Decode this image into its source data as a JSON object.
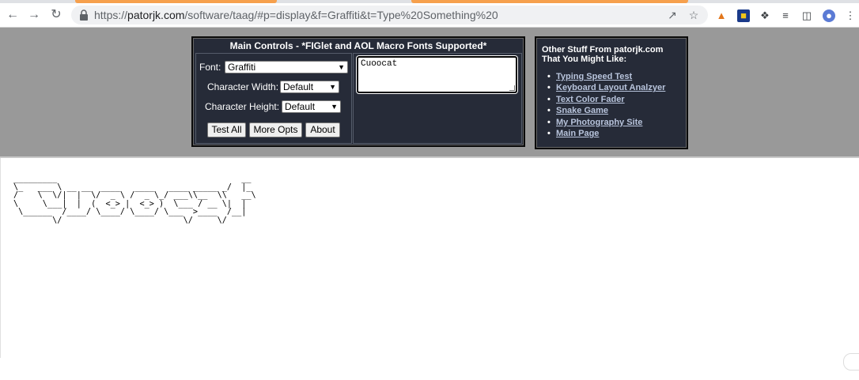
{
  "browser": {
    "url_prefix": "https://",
    "url_host": "patorjk.com",
    "url_rest": "/software/taag/#p=display&f=Graffiti&t=Type%20Something%20"
  },
  "main_controls": {
    "title": "Main Controls - *FIGlet and AOL Macro Fonts Supported*",
    "font_label": "Font:",
    "font_value": "Graffiti",
    "width_label": "Character Width:",
    "width_value": "Default",
    "height_label": "Character Height:",
    "height_value": "Default",
    "test_all_label": "Test All",
    "more_opts_label": "More Opts",
    "about_label": "About",
    "input_text": "Cuoocat"
  },
  "other_stuff": {
    "title_line1": "Other Stuff From patorjk.com",
    "title_line2": "That You Might Like:",
    "links": [
      "Typing Speed Test",
      "Keyboard Layout Analzyer",
      "Text Color Fader",
      "Snake Game",
      "My Photography Site",
      "Main Page"
    ]
  },
  "output": {
    "ascii_art": "_________                                      __    \n\\_   ___ \\ __ __  ____   ____   ____ _____ _/  |_  \n/    \\  \\/|  |  \\/  _ \\ /  _ \\_/ ___\\\\__  \\\\   __\\ \n\\     \\___|  |  (  <_> |  <_> )  \\___ / __ \\|  |   \n \\______  /____/ \\____/ \\____/ \\___  >____  /__|   \n        \\/                         \\/     \\/       "
  }
}
